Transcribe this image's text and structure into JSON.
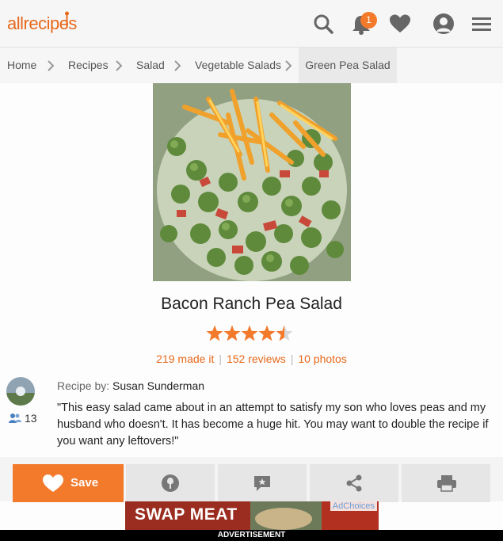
{
  "header": {
    "logo_text": "allrecipes",
    "notification_count": "1",
    "icons": [
      "search-icon",
      "bell-icon",
      "heart-icon",
      "profile-icon",
      "menu-icon"
    ],
    "accent_color": "#f3792b"
  },
  "breadcrumb": {
    "items": [
      "Home",
      "Recipes",
      "Salad",
      "Vegetable Salads"
    ],
    "current": "Green Pea Salad"
  },
  "recipe": {
    "title": "Bacon Ranch Pea Salad",
    "rating": 4.5,
    "rating_max": 5,
    "made_it": "219 made it",
    "reviews": "152 reviews",
    "photos": "10 photos",
    "by_label": "Recipe by:",
    "author": "Susan Sunderman",
    "followers": "13",
    "description": "\"This easy salad came about in an attempt to satisfy my son who loves peas and my husband who doesn't. It has become a huge hit. You may want to double the recipe if you want any leftovers!\""
  },
  "actions": {
    "save_label": "Save",
    "icons": [
      "heart-icon",
      "made-it-icon",
      "review-icon",
      "share-icon",
      "print-icon"
    ]
  },
  "ad": {
    "headline": "SWAP MEAT",
    "choices": "AdChoices",
    "label": "ADVERTISEMENT"
  }
}
